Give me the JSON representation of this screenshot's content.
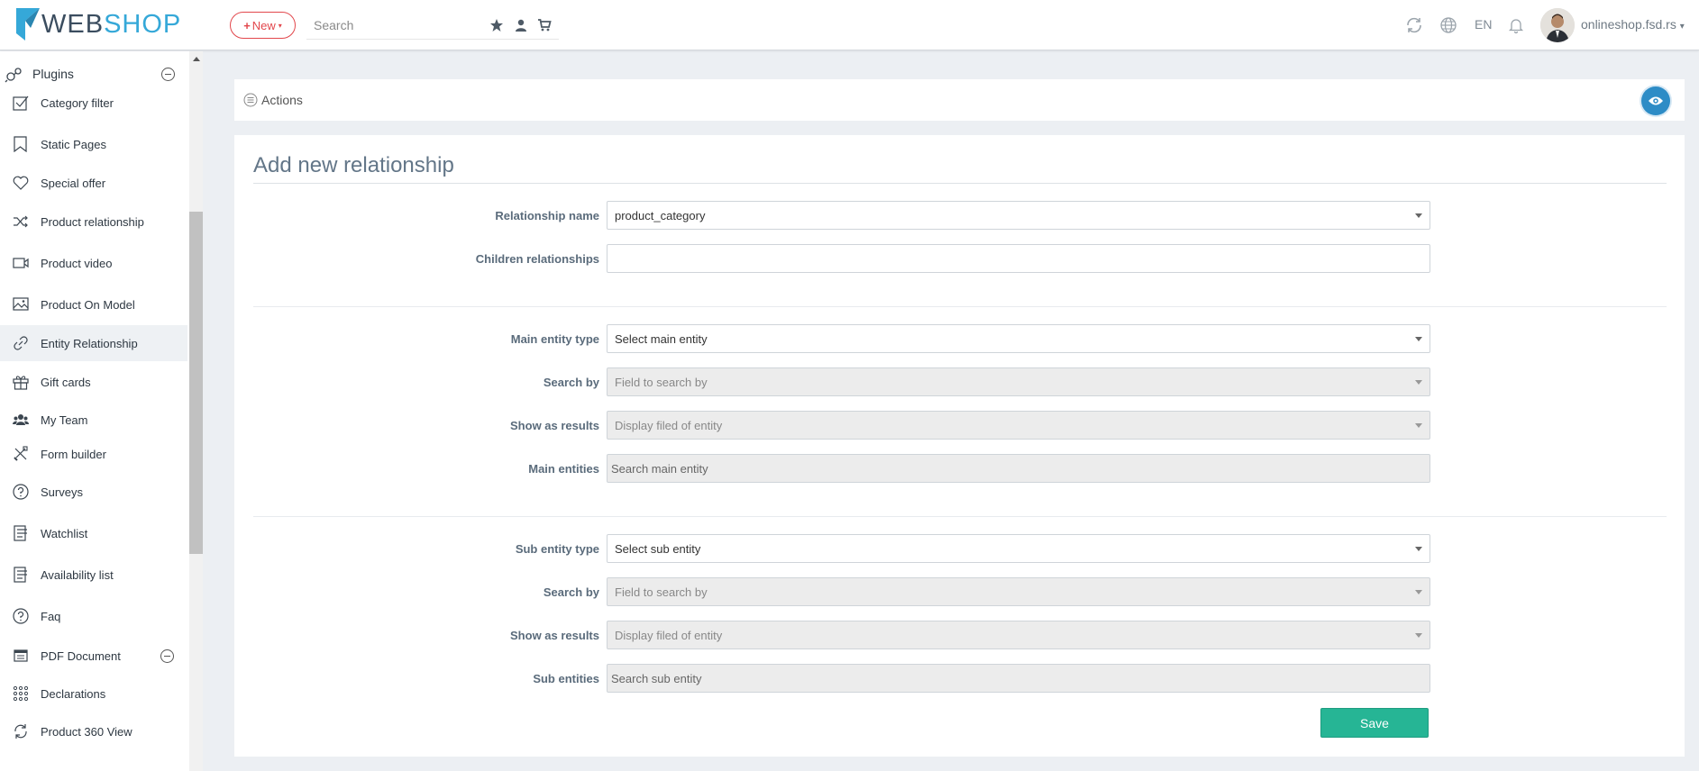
{
  "header": {
    "logo_part1": "WEB",
    "logo_part2": "SHOP",
    "new_label": "New",
    "search_placeholder": "Search",
    "language": "EN",
    "user_name": "onlineshop.fsd.rs"
  },
  "sidebar": {
    "section_title": "Plugins",
    "items": [
      {
        "label": "Category filter",
        "icon": "checkbox-icon"
      },
      {
        "label": "Static Pages",
        "icon": "bookmark-icon"
      },
      {
        "label": "Special offer",
        "icon": "heart-icon"
      },
      {
        "label": "Product relationship",
        "icon": "shuffle-icon"
      },
      {
        "label": "Product video",
        "icon": "video-icon"
      },
      {
        "label": "Product On Model",
        "icon": "image-icon"
      },
      {
        "label": "Entity Relationship",
        "icon": "link-icon",
        "active": true
      },
      {
        "label": "Gift cards",
        "icon": "gift-icon"
      },
      {
        "label": "My Team",
        "icon": "users-icon"
      },
      {
        "label": "Form builder",
        "icon": "tools-icon"
      },
      {
        "label": "Surveys",
        "icon": "question-icon"
      },
      {
        "label": "Watchlist",
        "icon": "list-icon"
      },
      {
        "label": "Availability list",
        "icon": "list-icon"
      },
      {
        "label": "Faq",
        "icon": "question-icon"
      },
      {
        "label": "PDF Document",
        "icon": "document-icon"
      },
      {
        "label": "Declarations",
        "icon": "grid-icon"
      },
      {
        "label": "Product 360 View",
        "icon": "rotate-icon"
      }
    ]
  },
  "actions": {
    "label": "Actions"
  },
  "form": {
    "title": "Add new relationship",
    "relationship_name": {
      "label": "Relationship name",
      "value": "product_category"
    },
    "children_relationships": {
      "label": "Children relationships",
      "value": ""
    },
    "main_entity_type": {
      "label": "Main entity type",
      "value": "Select main entity"
    },
    "main_search_by": {
      "label": "Search by",
      "value": "Field to search by"
    },
    "main_show_as_results": {
      "label": "Show as results",
      "value": "Display filed of entity"
    },
    "main_entities": {
      "label": "Main entities",
      "placeholder": "Search main entity"
    },
    "sub_entity_type": {
      "label": "Sub entity type",
      "value": "Select sub entity"
    },
    "sub_search_by": {
      "label": "Search by",
      "value": "Field to search by"
    },
    "sub_show_as_results": {
      "label": "Show as results",
      "value": "Display filed of entity"
    },
    "sub_entities": {
      "label": "Sub entities",
      "placeholder": "Search sub entity"
    },
    "save_label": "Save"
  },
  "colors": {
    "accent": "#35a8d8",
    "danger": "#e2474c",
    "save": "#26b595",
    "eye": "#2d8cc6"
  }
}
